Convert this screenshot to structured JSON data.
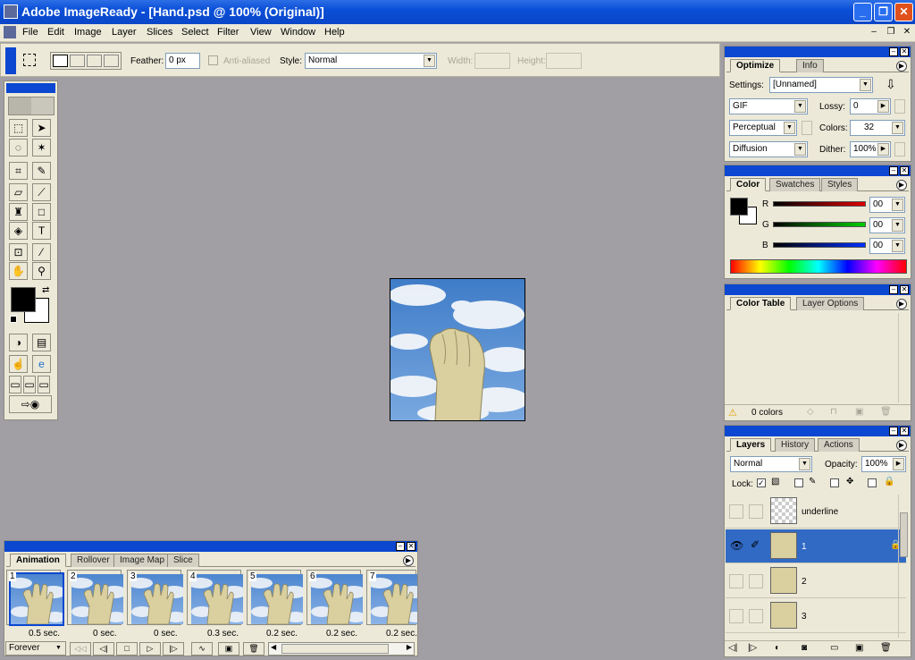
{
  "window": {
    "title": "Adobe ImageReady - [Hand.psd @ 100% (Original)]",
    "minimize": "_",
    "restore": "❐",
    "close": "✕"
  },
  "menu": [
    "File",
    "Edit",
    "Image",
    "Layer",
    "Slices",
    "Select",
    "Filter",
    "View",
    "Window",
    "Help"
  ],
  "mdi": {
    "minimize": "–",
    "restore": "❐",
    "close": "✕"
  },
  "options": {
    "feather_label": "Feather:",
    "feather_value": "0 px",
    "antialiased_label": "Anti-aliased",
    "style_label": "Style:",
    "style_value": "Normal",
    "width_label": "Width:",
    "height_label": "Height:"
  },
  "optimize": {
    "tabs": [
      "Optimize",
      "Info"
    ],
    "settings_label": "Settings:",
    "settings_value": "[Unnamed]",
    "format": "GIF",
    "lossy_label": "Lossy:",
    "lossy_value": "0",
    "palette": "Perceptual",
    "colors_label": "Colors:",
    "colors_value": "32",
    "dither_method": "Diffusion",
    "dither_label": "Dither:",
    "dither_value": "100%"
  },
  "color": {
    "tabs": [
      "Color",
      "Swatches",
      "Styles"
    ],
    "r_label": "R",
    "r_value": "00",
    "g_label": "G",
    "g_value": "00",
    "b_label": "B",
    "b_value": "00"
  },
  "colortable": {
    "tabs": [
      "Color Table",
      "Layer Options"
    ],
    "count": "0 colors"
  },
  "layers": {
    "tabs": [
      "Layers",
      "History",
      "Actions"
    ],
    "blend_mode": "Normal",
    "opacity_label": "Opacity:",
    "opacity_value": "100%",
    "lock_label": "Lock:",
    "rows": [
      {
        "name": "underline"
      },
      {
        "name": "1"
      },
      {
        "name": "2"
      },
      {
        "name": "3"
      }
    ]
  },
  "animation": {
    "tabs": [
      "Animation",
      "Rollover",
      "Image Map",
      "Slice"
    ],
    "loop": "Forever",
    "frames": [
      {
        "num": "1",
        "delay": "0.5 sec."
      },
      {
        "num": "2",
        "delay": "0 sec."
      },
      {
        "num": "3",
        "delay": "0 sec."
      },
      {
        "num": "4",
        "delay": "0.3 sec."
      },
      {
        "num": "5",
        "delay": "0.2 sec."
      },
      {
        "num": "6",
        "delay": "0.2 sec."
      },
      {
        "num": "7",
        "delay": "0.2 sec."
      }
    ]
  },
  "colors": {
    "titlebar": "#0a4fd8",
    "panel": "#ece9d8",
    "workspace": "#a19fa4",
    "selection": "#316ac5"
  }
}
